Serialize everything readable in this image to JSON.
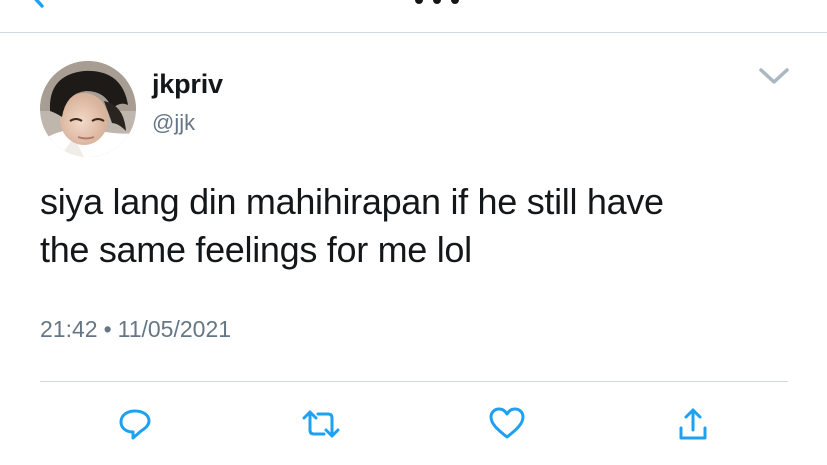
{
  "tweet": {
    "display_name": "jkpriv",
    "handle": "@jjk",
    "text_line1": "siya lang din mahihirapan if he still have",
    "text_line2": "the same feelings for me lol",
    "time": "21:42",
    "separator": "•",
    "date": "11/05/2021"
  },
  "icons": {
    "back": "back-chevron-icon",
    "caret": "chevron-down-icon",
    "reply": "reply-icon",
    "retweet": "retweet-icon",
    "like": "heart-icon",
    "share": "share-icon"
  },
  "colors": {
    "icon_blue": "#1da1f2",
    "text_dark": "#14171a",
    "text_gray": "#657786",
    "caret_gray": "#aab8c2",
    "divider": "#cfd9de"
  }
}
